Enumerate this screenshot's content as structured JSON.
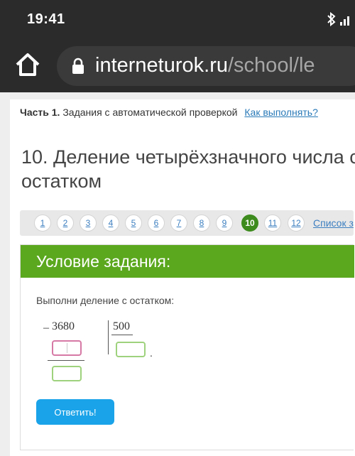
{
  "status_bar": {
    "time": "19:41",
    "icons": [
      "bluetooth-icon",
      "signal-icon"
    ]
  },
  "browser": {
    "url_host": "interneturok.ru",
    "url_path": "/school/le",
    "icons": [
      "home-icon",
      "lock-icon"
    ]
  },
  "breadcrumb": {
    "part_bold": "Часть 1.",
    "part_text": "Задания с автоматической проверкой",
    "how_link": "Как выполнять?"
  },
  "task": {
    "title": "10. Деление четырёхзначного числа с остатком"
  },
  "navigation": {
    "numbers": [
      "1",
      "2",
      "3",
      "4",
      "5",
      "6",
      "7",
      "8",
      "9",
      "10",
      "11",
      "12"
    ],
    "active": "10",
    "list_link": "Список з"
  },
  "card": {
    "header": "Условие задания:",
    "prompt": "Выполни деление с остатком:",
    "minus": "–",
    "dividend": "3680",
    "divisor": "500",
    "dot": ".",
    "button": "Ответить!"
  },
  "colors": {
    "header_green": "#5ba71d",
    "active_green": "#3c8b1c",
    "button_blue": "#1aa3e8",
    "link_blue": "#3c7fc0",
    "input_pink": "#d67aa5",
    "input_green": "#9fd27c"
  }
}
